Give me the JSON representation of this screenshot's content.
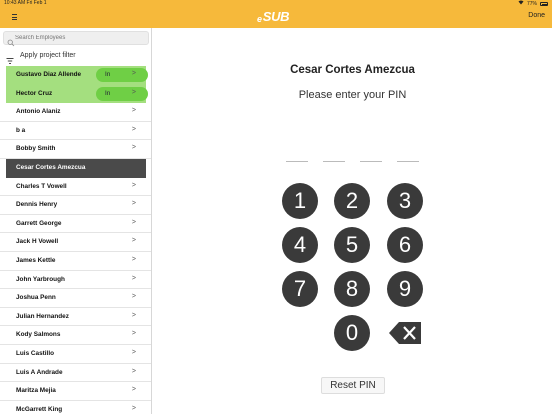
{
  "status_bar": {
    "time": "10:43 AM   Fri Feb 1",
    "battery": "77%"
  },
  "header": {
    "logo_prefix": "e",
    "logo_text": "SUB",
    "done_label": "Done"
  },
  "sidebar": {
    "search_placeholder": "Search Employees",
    "filter_label": "Apply project filter",
    "employees": [
      {
        "name": "Gustavo Diaz Allende",
        "status": "In",
        "chev": ">"
      },
      {
        "name": "Hector Cruz",
        "status": "In",
        "chev": ">"
      },
      {
        "name": "Antonio Alaniz",
        "chev": ">"
      },
      {
        "name": "b a",
        "chev": ">"
      },
      {
        "name": "Bobby Smith",
        "chev": ">"
      },
      {
        "name": "Cesar Cortes Amezcua",
        "chev": ">"
      },
      {
        "name": "Charles T Vowell",
        "chev": ">"
      },
      {
        "name": "Dennis Henry",
        "chev": ">"
      },
      {
        "name": "Garrett George",
        "chev": ">"
      },
      {
        "name": "Jack H Vowell",
        "chev": ">"
      },
      {
        "name": "James Kettle",
        "chev": ">"
      },
      {
        "name": "John Yarbrough",
        "chev": ">"
      },
      {
        "name": "Joshua Penn",
        "chev": ">"
      },
      {
        "name": "Julian Hernandez",
        "chev": ">"
      },
      {
        "name": "Kody Salmons",
        "chev": ">"
      },
      {
        "name": "Luis Castillo",
        "chev": ">"
      },
      {
        "name": "Luis A Andrade",
        "chev": ">"
      },
      {
        "name": "Maritza Mejia",
        "chev": ">"
      },
      {
        "name": "McGarrett King",
        "chev": ">"
      }
    ]
  },
  "pin_pad": {
    "employee_name": "Cesar Cortes Amezcua",
    "prompt": "Please enter your PIN",
    "keys": [
      "1",
      "2",
      "3",
      "4",
      "5",
      "6",
      "7",
      "8",
      "9",
      "0"
    ],
    "reset_label": "Reset PIN"
  },
  "colors": {
    "accent": "#f6b93b",
    "clocked_in_row": "#a4df7f",
    "clocked_in_badge": "#6fcf45",
    "selected_row": "#4a4a4a",
    "key": "#3a3a3a"
  }
}
